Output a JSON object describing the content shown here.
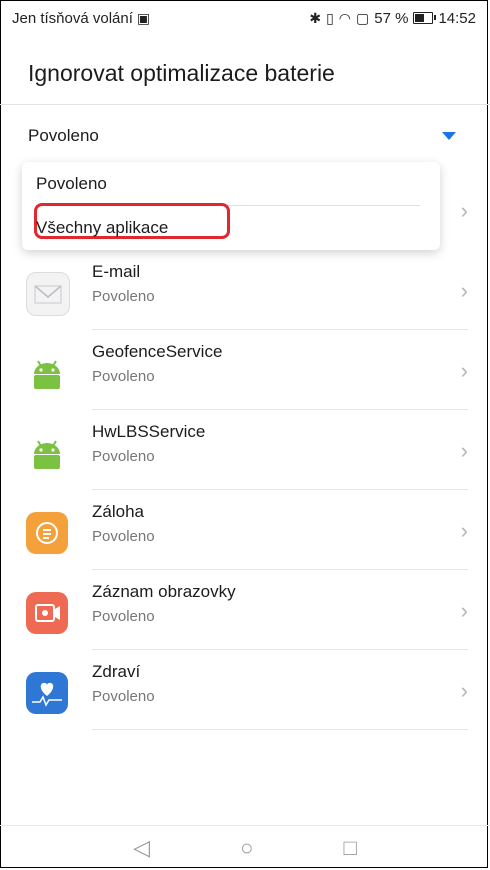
{
  "status": {
    "carrier": "Jen tísňová volání",
    "battery": "57 %",
    "battery_level": 0.57,
    "time": "14:52"
  },
  "header": {
    "title": "Ignorovat optimalizace baterie"
  },
  "filter": {
    "selected": "Povoleno"
  },
  "dropdown": {
    "options": [
      "Povoleno",
      "Všechny aplikace"
    ]
  },
  "apps": [
    {
      "name": "",
      "status": "",
      "icon": "partially-hidden-row"
    },
    {
      "name": "E-mail",
      "status": "Povoleno",
      "icon": "mail-icon"
    },
    {
      "name": "GeofenceService",
      "status": "Povoleno",
      "icon": "android-icon"
    },
    {
      "name": "HwLBSService",
      "status": "Povoleno",
      "icon": "android-icon"
    },
    {
      "name": "Záloha",
      "status": "Povoleno",
      "icon": "backup-icon"
    },
    {
      "name": "Záznam obrazovky",
      "status": "Povoleno",
      "icon": "screen-record-icon"
    },
    {
      "name": "Zdraví",
      "status": "Povoleno",
      "icon": "health-icon"
    }
  ],
  "navbar": {
    "back": "◁",
    "home": "○",
    "recents": "□"
  },
  "colors": {
    "accent": "#1a73e8",
    "highlight": "#e0282e"
  }
}
